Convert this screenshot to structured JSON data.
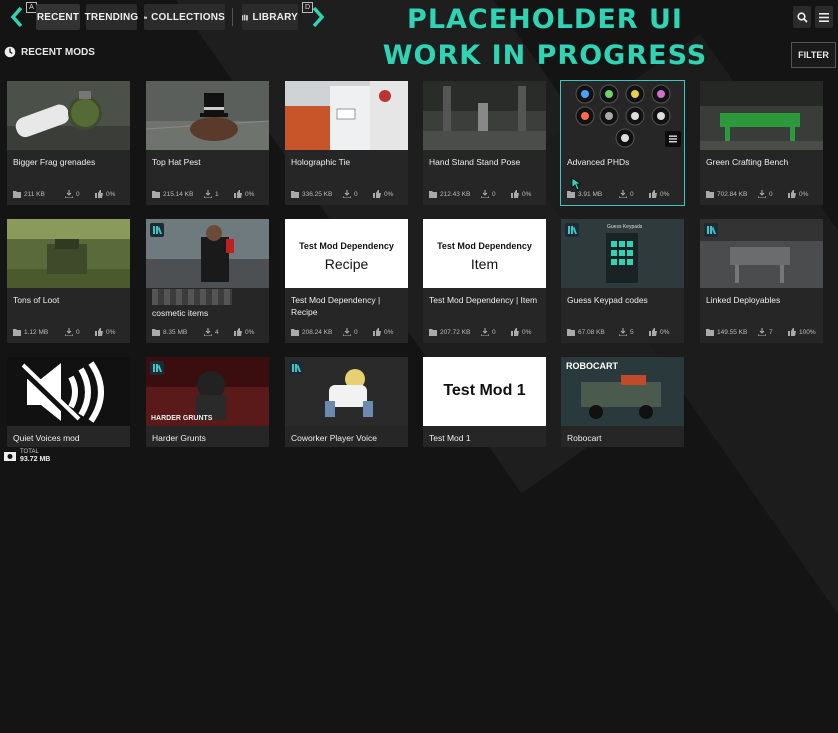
{
  "header": {
    "tabs": [
      {
        "label": "RECENT",
        "icon": "none"
      },
      {
        "label": "TRENDING",
        "icon": "none"
      },
      {
        "label": "COLLECTIONS",
        "icon": "folder-icon"
      },
      {
        "label": "LIBRARY",
        "icon": "library-icon"
      }
    ],
    "key_left": "A",
    "key_right": "D",
    "placeholder_line1": "PLACEHOLDER UI",
    "placeholder_line2": "WORK IN PROGRESS",
    "accent_color": "#2fd4b4",
    "filter_label": "FILTER"
  },
  "section": {
    "title": "RECENT MODS",
    "icon": "clock-icon"
  },
  "mods": [
    {
      "title": "Bigger Frag grenades",
      "size": "211 KB",
      "downloads": "0",
      "rating": "0%"
    },
    {
      "title": "Top Hat Pest",
      "size": "215.14 KB",
      "downloads": "1",
      "rating": "0%"
    },
    {
      "title": "Holographic Tie",
      "size": "336.25 KB",
      "downloads": "0",
      "rating": "0%"
    },
    {
      "title": "Hand Stand Stand Pose",
      "size": "212.43 KB",
      "downloads": "0",
      "rating": "0%"
    },
    {
      "title": "Advanced PHDs",
      "size": "3.91 MB",
      "downloads": "0",
      "rating": "0%"
    },
    {
      "title": "Green Crafting Bench",
      "size": "702.84 KB",
      "downloads": "0",
      "rating": "0%"
    },
    {
      "title": "Tons of Loot",
      "size": "1.12 MB",
      "downloads": "0",
      "rating": "0%"
    },
    {
      "title": "cosmetic items",
      "size": "8.35 MB",
      "downloads": "4",
      "rating": "0%"
    },
    {
      "title": "Test Mod Dependency | Recipe",
      "size": "208.24 KB",
      "downloads": "0",
      "rating": "0%",
      "thumb_line1": "Test Mod Dependency",
      "thumb_line2": "Recipe"
    },
    {
      "title": "Test Mod Dependency | Item",
      "size": "207.72 KB",
      "downloads": "0",
      "rating": "0%",
      "thumb_line1": "Test Mod Dependency",
      "thumb_line2": "Item"
    },
    {
      "title": "Guess Keypad codes",
      "size": "67.08 KB",
      "downloads": "5",
      "rating": "0%",
      "thumb_caption": "Guess Keypads"
    },
    {
      "title": "Linked Deployables",
      "size": "149.55 KB",
      "downloads": "7",
      "rating": "100%"
    },
    {
      "title": "Quiet Voices mod"
    },
    {
      "title": "Harder Grunts",
      "thumb_caption": "HARDER GRUNTS"
    },
    {
      "title": "Coworker Player Voice"
    },
    {
      "title": "Test Mod 1",
      "thumb_line1": "Test Mod 1"
    },
    {
      "title": "Robocart",
      "thumb_caption": "ROBOCART"
    }
  ],
  "footer": {
    "label": "TOTAL",
    "value": "93.72 MB"
  }
}
